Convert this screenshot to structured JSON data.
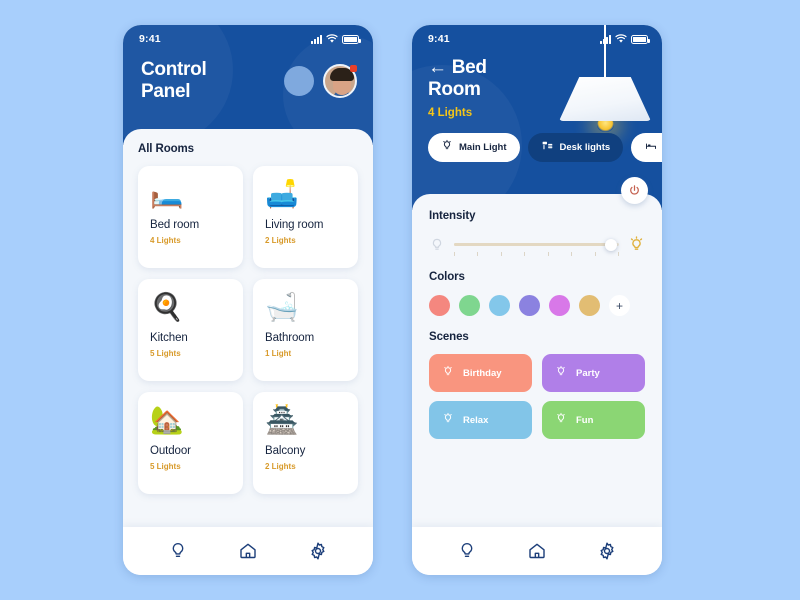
{
  "theme": {
    "page_background": "#a8cffc",
    "header_blue": "#15509f",
    "sheet_background": "#f4f7fb",
    "accent_yellow": "#f5c518",
    "sub_text_gold": "#d89a2a",
    "chip_active": "#10407f",
    "power_icon": "#c4604f"
  },
  "left_screen": {
    "status_bar": {
      "time": "9:41",
      "signal_icon": "signal-bars-icon",
      "wifi_icon": "wifi-icon",
      "battery_icon": "battery-icon"
    },
    "header": {
      "title_line1": "Control",
      "title_line2": "Panel",
      "placeholder_circle": "blue-circle",
      "avatar": "user-avatar",
      "notification_badge": "unread-dot"
    },
    "section_title": "All Rooms",
    "rooms": [
      {
        "name": "Bed room",
        "lights": "4 Lights",
        "icon": "🛏️",
        "icon_name": "bed-icon"
      },
      {
        "name": "Living room",
        "lights": "2 Lights",
        "icon": "🛋️",
        "icon_name": "sofa-icon"
      },
      {
        "name": "Kitchen",
        "lights": "5 Lights",
        "icon": "🍳",
        "icon_name": "kitchen-icon"
      },
      {
        "name": "Bathroom",
        "lights": "1 Light",
        "icon": "🛁",
        "icon_name": "bathtub-icon"
      },
      {
        "name": "Outdoor",
        "lights": "5 Lights",
        "icon": "🏡",
        "icon_name": "house-icon"
      },
      {
        "name": "Balcony",
        "lights": "2 Lights",
        "icon": "🏯",
        "icon_name": "balcony-icon"
      }
    ],
    "bottom_nav": [
      {
        "icon_name": "bulb-icon",
        "label": "Lights"
      },
      {
        "icon_name": "home-icon",
        "label": "Home"
      },
      {
        "icon_name": "gear-icon",
        "label": "Settings"
      }
    ]
  },
  "right_screen": {
    "status_bar": {
      "time": "9:41",
      "signal_icon": "signal-bars-icon",
      "wifi_icon": "wifi-icon",
      "battery_icon": "battery-icon"
    },
    "header": {
      "back_arrow": "←",
      "title_line1": "Bed",
      "title_line2": "Room",
      "lights_count": "4 Lights",
      "lamp_icon": "pendant-lamp-icon"
    },
    "chips": [
      {
        "label": "Main Light",
        "icon_name": "bulb-icon",
        "active": false
      },
      {
        "label": "Desk lights",
        "icon_name": "desk-lamp-icon",
        "active": true
      },
      {
        "label": "Bed",
        "icon_name": "bed-icon",
        "active": false
      }
    ],
    "power_button": {
      "icon_name": "power-icon"
    },
    "intensity": {
      "label": "Intensity",
      "value_percent": 95,
      "min_icon": "dim-bulb-icon",
      "max_icon": "bright-bulb-icon"
    },
    "colors": {
      "label": "Colors",
      "swatches": [
        "#f4877f",
        "#7fd68f",
        "#83c7ea",
        "#8b82e0",
        "#d878e8",
        "#e2bd73"
      ],
      "add_label": "+"
    },
    "scenes": {
      "label": "Scenes",
      "items": [
        {
          "label": "Birthday",
          "color": "#f9957f",
          "icon_name": "bulb-icon"
        },
        {
          "label": "Party",
          "color": "#b07fe8",
          "icon_name": "bulb-icon"
        },
        {
          "label": "Relax",
          "color": "#82c5e8",
          "icon_name": "bulb-icon"
        },
        {
          "label": "Fun",
          "color": "#8bd674",
          "icon_name": "bulb-icon"
        }
      ]
    },
    "bottom_nav": [
      {
        "icon_name": "bulb-icon",
        "label": "Lights"
      },
      {
        "icon_name": "home-icon",
        "label": "Home"
      },
      {
        "icon_name": "gear-icon",
        "label": "Settings"
      }
    ]
  }
}
